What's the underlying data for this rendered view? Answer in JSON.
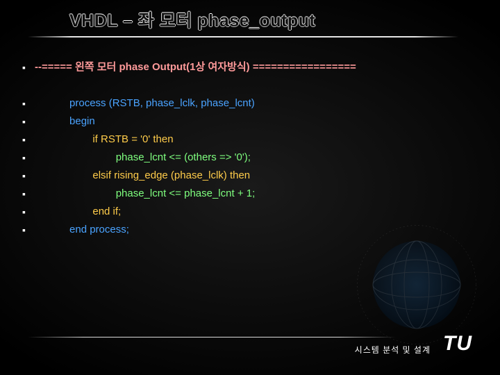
{
  "title": "VHDL – 좌 모터 phase_output",
  "lines": [
    {
      "cls": "c-header",
      "indent": 0,
      "text": "--===== 왼쪽 모터 phase Output(1상 여자방식) ================="
    },
    {
      "cls": "",
      "indent": 0,
      "text": ""
    },
    {
      "cls": "c-key",
      "indent": 3,
      "text": "process (RSTB, phase_lclk, phase_lcnt)"
    },
    {
      "cls": "c-key",
      "indent": 3,
      "text": "begin"
    },
    {
      "cls": "c-ctrl",
      "indent": 5,
      "text": "if RSTB = '0' then"
    },
    {
      "cls": "c-assign",
      "indent": 7,
      "text": "phase_lcnt <= (others => '0');"
    },
    {
      "cls": "c-ctrl",
      "indent": 5,
      "text": "elsif rising_edge (phase_lclk) then"
    },
    {
      "cls": "c-assign",
      "indent": 7,
      "text": "phase_lcnt <= phase_lcnt + 1;"
    },
    {
      "cls": "c-ctrl",
      "indent": 5,
      "text": "end if;"
    },
    {
      "cls": "c-key",
      "indent": 3,
      "text": "end process;"
    }
  ],
  "footer": {
    "label": "시스템 분석 및 설계",
    "logo": "TU"
  }
}
